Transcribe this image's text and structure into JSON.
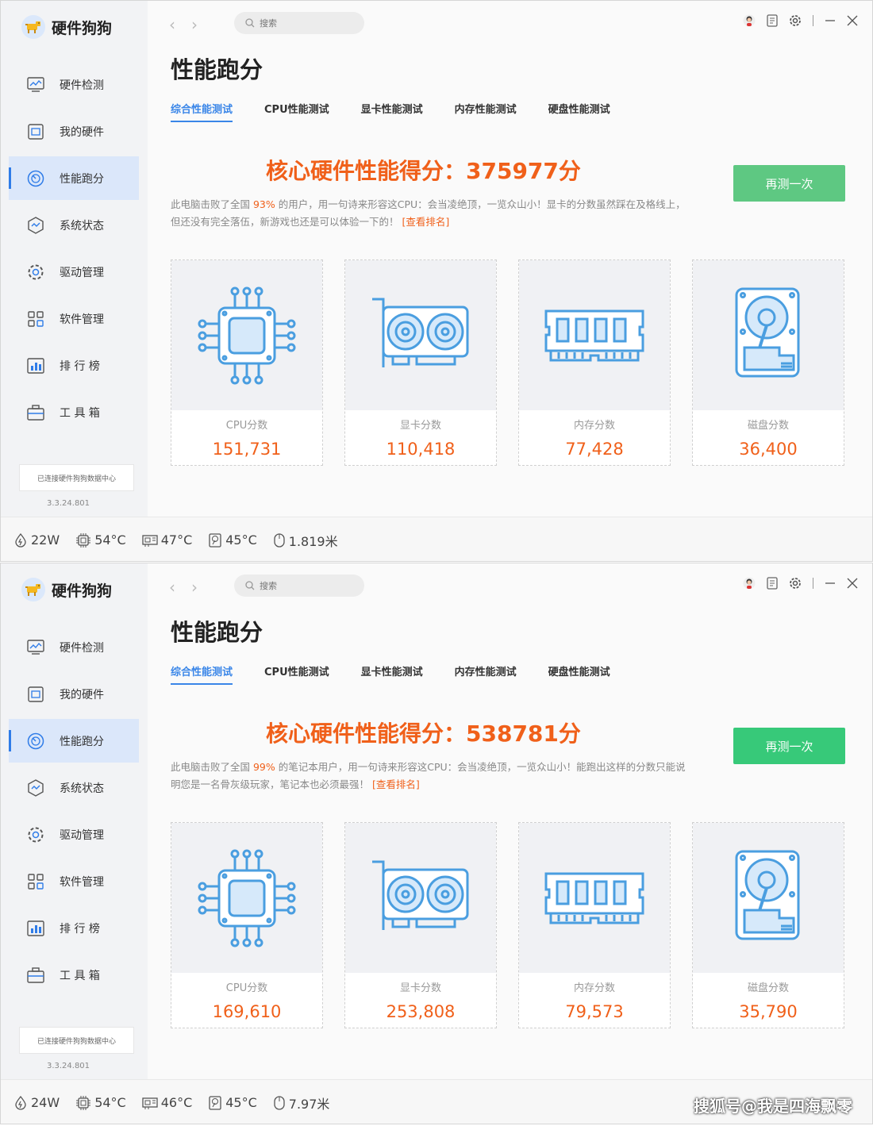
{
  "app": {
    "name": "硬件狗狗",
    "search_placeholder": "搜索",
    "page_title": "性能跑分",
    "connect_status": "已连接硬件狗狗数据中心",
    "version": "3.3.24.801",
    "nav": [
      {
        "label": "硬件检测",
        "icon": "monitor-chart-icon"
      },
      {
        "label": "我的硬件",
        "icon": "hardware-list-icon"
      },
      {
        "label": "性能跑分",
        "icon": "speedometer-icon"
      },
      {
        "label": "系统状态",
        "icon": "system-status-icon"
      },
      {
        "label": "驱动管理",
        "icon": "gear-icon"
      },
      {
        "label": "软件管理",
        "icon": "apps-grid-icon"
      },
      {
        "label": "排 行 榜",
        "icon": "ranking-icon"
      },
      {
        "label": "工 具 箱",
        "icon": "toolbox-icon"
      }
    ],
    "tabs": [
      "综合性能测试",
      "CPU性能测试",
      "显卡性能测试",
      "内存性能测试",
      "硬盘性能测试"
    ],
    "retest_label": "再测一次",
    "card_labels": [
      "CPU分数",
      "显卡分数",
      "内存分数",
      "磁盘分数"
    ]
  },
  "windows": [
    {
      "score_text": "核心硬件性能得分：375977分",
      "desc_pre": "此电脑击败了全国 ",
      "desc_pct": "93%",
      "desc_post": " 的用户，用一句诗来形容这CPU：会当凌绝顶，一览众山小！显卡的分数虽然踩在及格线上，但还没有完全落伍，新游戏也还是可以体验一下的！ ",
      "rank_link": "[查看排名]",
      "scores": [
        "151,731",
        "110,418",
        "77,428",
        "36,400"
      ],
      "status": {
        "power": "22W",
        "cpu_temp": "54°C",
        "gpu_temp": "47°C",
        "disk_temp": "45°C",
        "mouse": "1.819米"
      }
    },
    {
      "score_text": "核心硬件性能得分：538781分",
      "desc_pre": "此电脑击败了全国 ",
      "desc_pct": "99%",
      "desc_post": " 的笔记本用户，用一句诗来形容这CPU：会当凌绝顶，一览众山小！能跑出这样的分数只能说明您是一名骨灰级玩家，笔记本也必须最强！ ",
      "rank_link": "[查看排名]",
      "scores": [
        "169,610",
        "253,808",
        "79,573",
        "35,790"
      ],
      "status": {
        "power": "24W",
        "cpu_temp": "54°C",
        "gpu_temp": "46°C",
        "disk_temp": "45°C",
        "mouse": "7.97米"
      }
    }
  ],
  "watermark": "搜狐号@我是四海飘零",
  "colors": {
    "accent": "#3a86e8",
    "score": "#f0601a",
    "button": "#37c979",
    "icon": "#4a9ee0"
  }
}
